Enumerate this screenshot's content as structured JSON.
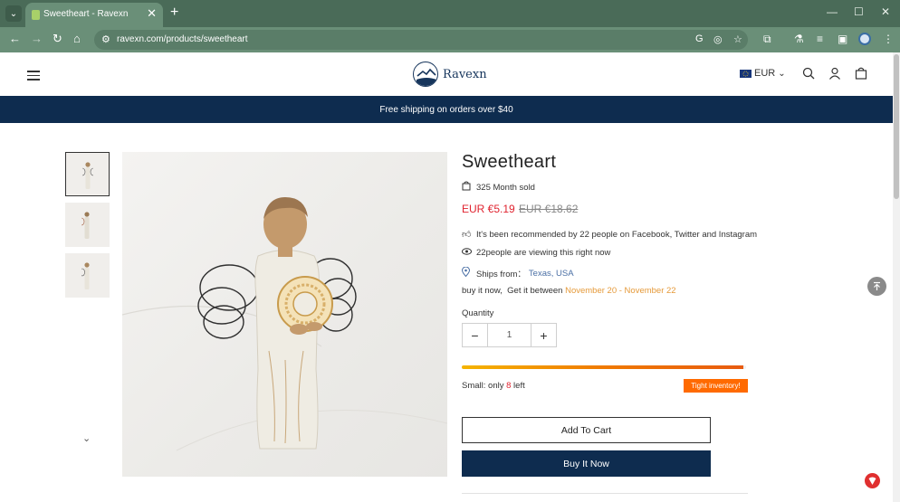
{
  "browser": {
    "tab_title": "Sweetheart - Ravexn",
    "tab_close": "✕",
    "new_tab": "+",
    "url": "ravexn.com/products/sweetheart",
    "window_controls": {
      "minimize": "—",
      "maximize": "☐",
      "close": "✕"
    }
  },
  "header": {
    "logo_text": "Ravexn",
    "currency": "EUR",
    "currency_caret": "⌄"
  },
  "promo": {
    "text": "Free shipping on orders over $40"
  },
  "product": {
    "title": "Sweetheart",
    "sold": "325 Month sold",
    "price": "EUR €5.19",
    "old_price": "EUR €18.62",
    "recommended": "It's been recommended by 22 people on Facebook, Twitter and Instagram",
    "viewing": "22people are viewing this right now",
    "ships_label": "Ships from：",
    "ships_from": "Texas, USA",
    "delivery_prefix": "buy it now,  Get it between ",
    "delivery_range": "November 20 - November 22",
    "quantity_label": "Quantity",
    "quantity_value": "1",
    "minus": "−",
    "plus": "+",
    "stock_prefix": "Small: only ",
    "stock_count": "8",
    "stock_suffix": " left",
    "inventory_badge": "Tight inventory!",
    "inventory_level": 0.99,
    "add_to_cart": "Add To Cart",
    "buy_now": "Buy It Now"
  },
  "colors": {
    "navy": "#0e2c4f",
    "price_red": "#e0232f",
    "date_orange": "#e59a3a",
    "badge_orange": "#ff6a00",
    "chrome_green": "#6a8f78"
  }
}
